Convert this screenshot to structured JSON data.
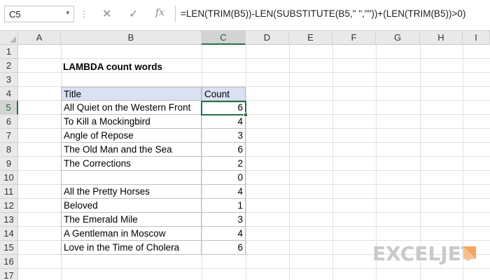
{
  "formula_bar": {
    "name_box": "C5",
    "name_box_arrow": "▾",
    "dots": "⋮",
    "cancel_icon": "✕",
    "enter_icon": "✓",
    "fx_label": "fx",
    "formula": "=LEN(TRIM(B5))-LEN(SUBSTITUTE(B5,\" \",\"\"))+(LEN(TRIM(B5))>0)"
  },
  "columns": [
    "A",
    "B",
    "C",
    "D",
    "E",
    "F",
    "G",
    "H",
    "I"
  ],
  "selected_column": "C",
  "rows": [
    "1",
    "2",
    "3",
    "4",
    "5",
    "6",
    "7",
    "8",
    "9",
    "10",
    "11",
    "12",
    "13",
    "14",
    "15",
    "16",
    "17"
  ],
  "selected_row": "5",
  "heading": "LAMBDA count words",
  "table": {
    "headers": {
      "title": "Title",
      "count": "Count"
    },
    "rows": [
      {
        "title": "All Quiet on the Western Front",
        "count": "6"
      },
      {
        "title": "To Kill a Mockingbird",
        "count": "4"
      },
      {
        "title": "Angle of Repose",
        "count": "3"
      },
      {
        "title": "The Old Man and the Sea",
        "count": "6"
      },
      {
        "title": "The Corrections",
        "count": "2"
      },
      {
        "title": "",
        "count": "0"
      },
      {
        "title": "All the Pretty Horses",
        "count": "4"
      },
      {
        "title": "Beloved",
        "count": "1"
      },
      {
        "title": "The Emerald Mile",
        "count": "3"
      },
      {
        "title": "A Gentleman in Moscow",
        "count": "4"
      },
      {
        "title": "Love in the Time of Cholera",
        "count": "6"
      }
    ]
  },
  "watermark": {
    "text": "EXCELJET",
    "color": "#c9c9c9",
    "accent": "#f5a45d"
  },
  "colors": {
    "selection_green": "#217346",
    "header_fill": "#d9e1f2"
  }
}
